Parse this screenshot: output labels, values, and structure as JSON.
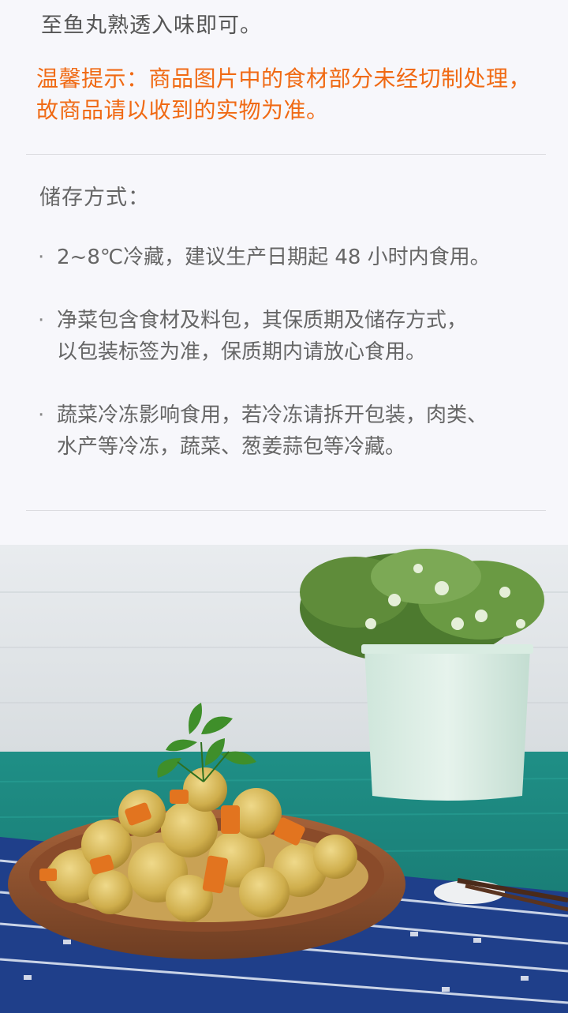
{
  "intro_tail": "至鱼丸熟透入味即可。",
  "tip": {
    "line1": "温馨提示：商品图片中的食材部分未经切制处理，",
    "line2": "故商品请以收到的实物为准。"
  },
  "storage": {
    "title": "储存方式：",
    "bullet_symbol": "·",
    "items": [
      {
        "line1": "2~8℃冷藏，建议生产日期起 48 小时内食用。",
        "line2": ""
      },
      {
        "line1": "净菜包含食材及料包，其保质期及储存方式，",
        "line2": "以包装标签为准，保质期内请放心食用。"
      },
      {
        "line1": "蔬菜冷冻影响食用，若冷冻请拆开包装，肉类、",
        "line2": "水产等冷冻，蔬菜、葱姜蒜包等冷藏。"
      }
    ]
  },
  "colors": {
    "tip": "#f06a14",
    "text": "#666666",
    "background": "#f7f7fb"
  }
}
